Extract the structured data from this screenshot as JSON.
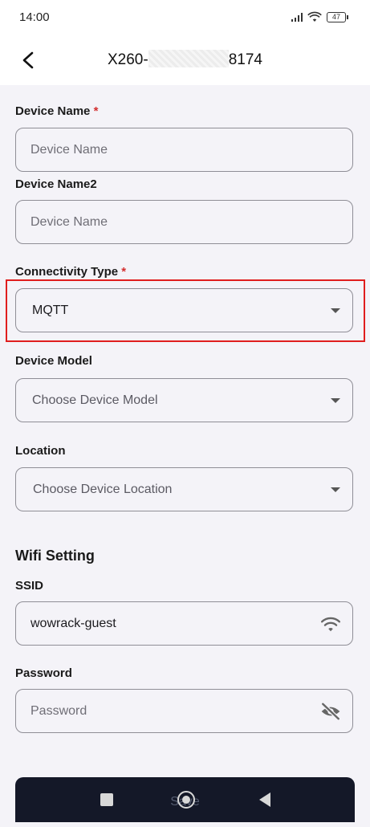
{
  "status_bar": {
    "time": "14:00",
    "battery": "47"
  },
  "header": {
    "title_prefix": "X260-",
    "title_suffix": "8174"
  },
  "form": {
    "device_name": {
      "label": "Device Name",
      "required_mark": "*",
      "placeholder": "Device Name",
      "value": ""
    },
    "device_name2": {
      "label": "Device Name2",
      "placeholder": "Device Name",
      "value": ""
    },
    "connectivity_type": {
      "label": "Connectivity Type",
      "required_mark": "*",
      "selected": "MQTT"
    },
    "device_model": {
      "label": "Device Model",
      "placeholder": "Choose Device Model"
    },
    "location": {
      "label": "Location",
      "placeholder": "Choose Device Location"
    },
    "wifi_section_title": "Wifi Setting",
    "ssid": {
      "label": "SSID",
      "value": "wowrack-guest"
    },
    "password": {
      "label": "Password",
      "placeholder": "Password",
      "value": ""
    }
  },
  "bottom_button": {
    "label": "Save"
  },
  "icons": [
    "back-arrow-icon",
    "wifi-icon",
    "eye-off-icon",
    "chevron-down-icon"
  ],
  "colors": {
    "required": "#d32f2f",
    "highlight": "#e01e1e",
    "button_bg": "#141828"
  }
}
